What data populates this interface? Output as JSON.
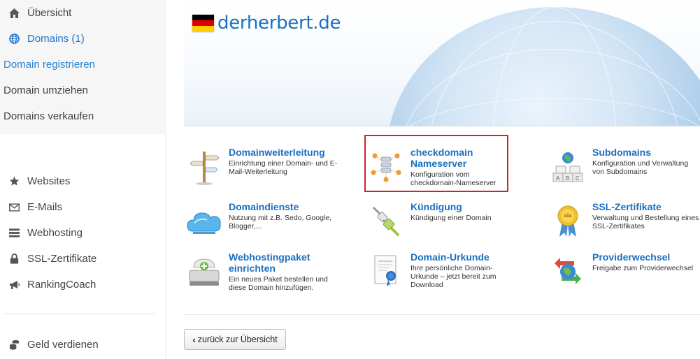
{
  "sidebar": {
    "top_items": [
      {
        "label": "Übersicht",
        "icon": "home-icon"
      },
      {
        "label": "Domains (1)",
        "icon": "globe-icon"
      }
    ],
    "sub_items": [
      {
        "label": "Domain registrieren"
      },
      {
        "label": "Domain umziehen"
      },
      {
        "label": "Domains verkaufen"
      }
    ],
    "items": [
      {
        "label": "Websites",
        "icon": "star-icon"
      },
      {
        "label": "E-Mails",
        "icon": "envelope-icon"
      },
      {
        "label": "Webhosting",
        "icon": "server-icon"
      },
      {
        "label": "SSL-Zertifikate",
        "icon": "lock-icon"
      },
      {
        "label": "RankingCoach",
        "icon": "megaphone-icon"
      }
    ],
    "bottom_items": [
      {
        "label": "Geld verdienen",
        "icon": "coins-icon"
      }
    ]
  },
  "header": {
    "domain": "derherbert.de",
    "flag_colors": [
      "#000000",
      "#dd0000",
      "#ffce00"
    ]
  },
  "tiles": [
    {
      "title": "Domainweiterleitung",
      "desc": "Einrichtung einer Domain- und E-Mail-Weiterleitung",
      "icon": "signpost-icon"
    },
    {
      "title": "checkdomain Nameserver",
      "desc": "Konfiguration vom checkdomain-Nameserver",
      "icon": "nameserver-icon"
    },
    {
      "title": "Subdomains",
      "desc": "Konfiguration und Verwaltung von Subdomains",
      "icon": "abc-blocks-icon"
    },
    {
      "title": "Domaindienste",
      "desc": "Nutzung mit z.B. Sedo, Google, Blogger,...",
      "icon": "cloud-icon"
    },
    {
      "title": "Kündigung",
      "desc": "Kündigung einer Domain",
      "icon": "unplug-icon"
    },
    {
      "title": "SSL-Zertifikate",
      "desc": "Verwaltung und Bestellung eines SSL-Zertifikates",
      "icon": "award-icon"
    },
    {
      "title": "Webhostingpaket einrichten",
      "desc": "Ein neues Paket bestellen und diese Domain hinzufügen.",
      "icon": "hosting-add-icon"
    },
    {
      "title": "Domain-Urkunde",
      "desc": "Ihre persönliche Domain-Urkunde – jetzt bereit zum Download",
      "icon": "certificate-icon"
    },
    {
      "title": "Providerwechsel",
      "desc": "Freigabe zum Providerwechsel",
      "icon": "switch-globe-icon"
    }
  ],
  "back_button": {
    "label": "zurück zur Übersicht"
  },
  "colors": {
    "accent": "#1a6fc0",
    "highlight": "#d1222a"
  }
}
